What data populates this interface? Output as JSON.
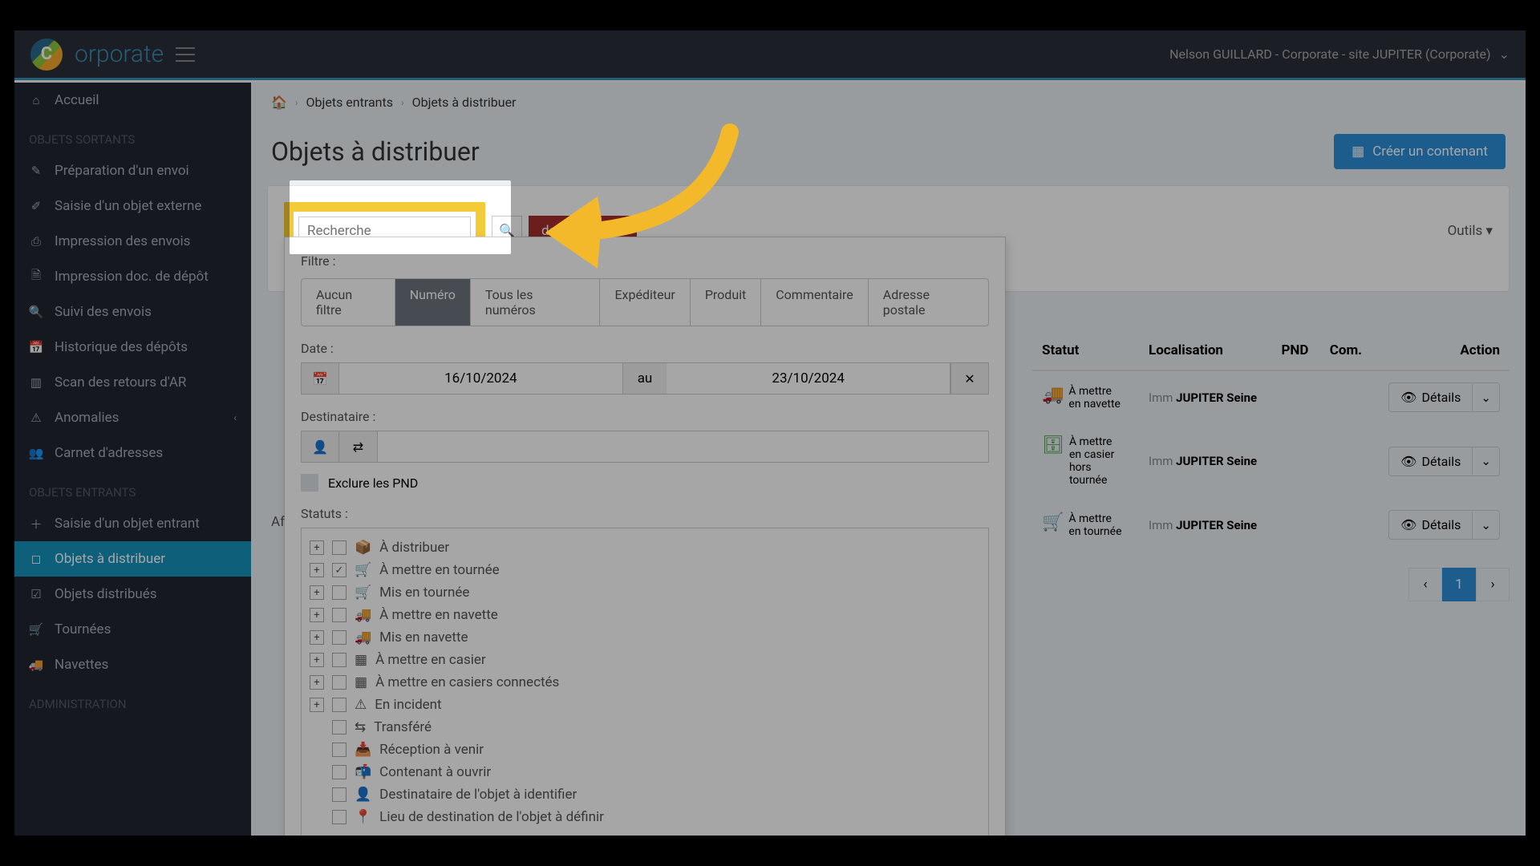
{
  "topbar": {
    "logo_letter": "C",
    "logo_text": "orporate",
    "user_text": "Nelson GUILLARD - Corporate - site JUPITER (Corporate)"
  },
  "sidebar": {
    "home": "Accueil",
    "section1": "OBJETS SORTANTS",
    "items1": {
      "prep": "Préparation d'un envoi",
      "saisie_ext": "Saisie d'un objet externe",
      "impr_env": "Impression des envois",
      "impr_doc": "Impression doc. de dépôt",
      "suivi": "Suivi des envois",
      "histo": "Historique des dépôts",
      "scan_ar": "Scan des retours d'AR",
      "anomalies": "Anomalies",
      "carnet": "Carnet d'adresses"
    },
    "section2": "OBJETS ENTRANTS",
    "items2": {
      "saisie_in": "Saisie d'un objet entrant",
      "distrib": "Objets à distribuer",
      "distribues": "Objets distribués",
      "tournees": "Tournées",
      "navettes": "Navettes"
    },
    "section3": "ADMINISTRATION"
  },
  "breadcrumb": {
    "item1": "Objets entrants",
    "item2": "Objets à distribuer"
  },
  "page": {
    "title": "Objets à distribuer",
    "create_btn": "Créer un contenant",
    "af_label": "Af"
  },
  "search": {
    "placeholder": "Recherche",
    "filter_badge": "derniers jours",
    "tools": "Outils"
  },
  "filter": {
    "label": "Filtre :",
    "tab_none": "Aucun filtre",
    "tab_num": "Numéro",
    "tab_allnum": "Tous les numéros",
    "tab_exp": "Expéditeur",
    "tab_prod": "Produit",
    "tab_comm": "Commentaire",
    "tab_addr": "Adresse postale",
    "date_label": "Date :",
    "date_from": "16/10/2024",
    "date_au": "au",
    "date_to": "23/10/2024",
    "dest_label": "Destinataire :",
    "exclude_pnd": "Exclure les PND",
    "status_label": "Statuts :",
    "statuses": {
      "s1": "À distribuer",
      "s2": "À mettre en tournée",
      "s3": "Mis en tournée",
      "s4": "À mettre en navette",
      "s5": "Mis en navette",
      "s6": "À mettre en casier",
      "s7": "À mettre en casiers connectés",
      "s8": "En incident",
      "s9": "Transféré",
      "s10": "Réception à venir",
      "s11": "Contenant à ouvrir",
      "s12": "Destinataire de l'objet à identifier",
      "s13": "Lieu de destination de l'objet à définir"
    }
  },
  "table": {
    "th_statut": "Statut",
    "th_loc": "Localisation",
    "th_pnd": "PND",
    "th_com": "Com.",
    "th_action": "Action",
    "rows": {
      "r1_status": "À mettre en navette",
      "r1_loc_prefix": "Imm",
      "r1_loc_name": "JUPITER Seine",
      "r2_status": "À mettre en casier hors tournée",
      "r2_loc_prefix": "Imm",
      "r2_loc_name": "JUPITER Seine",
      "r3_status": "À mettre en tournée",
      "r3_loc_prefix": "Imm",
      "r3_loc_name": "JUPITER Seine"
    },
    "details_btn": "Détails",
    "page_current": "1"
  }
}
